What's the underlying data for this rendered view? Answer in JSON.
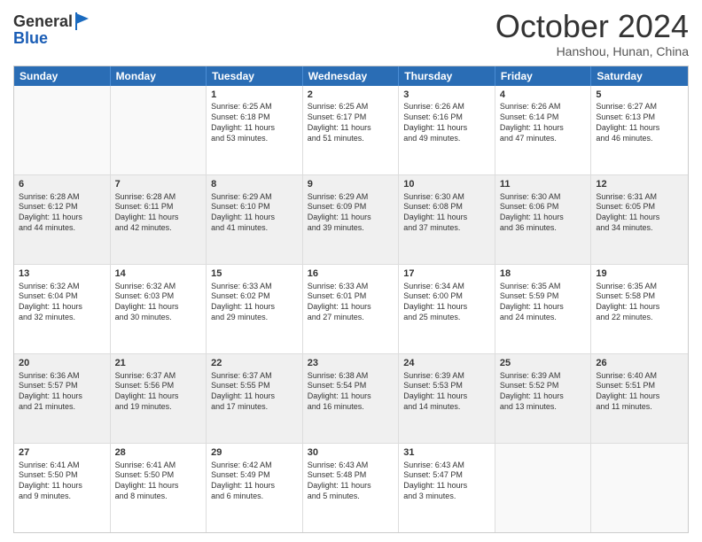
{
  "header": {
    "logo": {
      "line1": "General",
      "line2": "Blue"
    },
    "title": "October 2024",
    "subtitle": "Hanshou, Hunan, China"
  },
  "weekdays": [
    "Sunday",
    "Monday",
    "Tuesday",
    "Wednesday",
    "Thursday",
    "Friday",
    "Saturday"
  ],
  "rows": [
    [
      {
        "day": "",
        "lines": [],
        "empty": true,
        "shaded": false
      },
      {
        "day": "",
        "lines": [],
        "empty": true,
        "shaded": false
      },
      {
        "day": "1",
        "lines": [
          "Sunrise: 6:25 AM",
          "Sunset: 6:18 PM",
          "Daylight: 11 hours",
          "and 53 minutes."
        ],
        "empty": false,
        "shaded": false
      },
      {
        "day": "2",
        "lines": [
          "Sunrise: 6:25 AM",
          "Sunset: 6:17 PM",
          "Daylight: 11 hours",
          "and 51 minutes."
        ],
        "empty": false,
        "shaded": false
      },
      {
        "day": "3",
        "lines": [
          "Sunrise: 6:26 AM",
          "Sunset: 6:16 PM",
          "Daylight: 11 hours",
          "and 49 minutes."
        ],
        "empty": false,
        "shaded": false
      },
      {
        "day": "4",
        "lines": [
          "Sunrise: 6:26 AM",
          "Sunset: 6:14 PM",
          "Daylight: 11 hours",
          "and 47 minutes."
        ],
        "empty": false,
        "shaded": false
      },
      {
        "day": "5",
        "lines": [
          "Sunrise: 6:27 AM",
          "Sunset: 6:13 PM",
          "Daylight: 11 hours",
          "and 46 minutes."
        ],
        "empty": false,
        "shaded": false
      }
    ],
    [
      {
        "day": "6",
        "lines": [
          "Sunrise: 6:28 AM",
          "Sunset: 6:12 PM",
          "Daylight: 11 hours",
          "and 44 minutes."
        ],
        "empty": false,
        "shaded": true
      },
      {
        "day": "7",
        "lines": [
          "Sunrise: 6:28 AM",
          "Sunset: 6:11 PM",
          "Daylight: 11 hours",
          "and 42 minutes."
        ],
        "empty": false,
        "shaded": true
      },
      {
        "day": "8",
        "lines": [
          "Sunrise: 6:29 AM",
          "Sunset: 6:10 PM",
          "Daylight: 11 hours",
          "and 41 minutes."
        ],
        "empty": false,
        "shaded": true
      },
      {
        "day": "9",
        "lines": [
          "Sunrise: 6:29 AM",
          "Sunset: 6:09 PM",
          "Daylight: 11 hours",
          "and 39 minutes."
        ],
        "empty": false,
        "shaded": true
      },
      {
        "day": "10",
        "lines": [
          "Sunrise: 6:30 AM",
          "Sunset: 6:08 PM",
          "Daylight: 11 hours",
          "and 37 minutes."
        ],
        "empty": false,
        "shaded": true
      },
      {
        "day": "11",
        "lines": [
          "Sunrise: 6:30 AM",
          "Sunset: 6:06 PM",
          "Daylight: 11 hours",
          "and 36 minutes."
        ],
        "empty": false,
        "shaded": true
      },
      {
        "day": "12",
        "lines": [
          "Sunrise: 6:31 AM",
          "Sunset: 6:05 PM",
          "Daylight: 11 hours",
          "and 34 minutes."
        ],
        "empty": false,
        "shaded": true
      }
    ],
    [
      {
        "day": "13",
        "lines": [
          "Sunrise: 6:32 AM",
          "Sunset: 6:04 PM",
          "Daylight: 11 hours",
          "and 32 minutes."
        ],
        "empty": false,
        "shaded": false
      },
      {
        "day": "14",
        "lines": [
          "Sunrise: 6:32 AM",
          "Sunset: 6:03 PM",
          "Daylight: 11 hours",
          "and 30 minutes."
        ],
        "empty": false,
        "shaded": false
      },
      {
        "day": "15",
        "lines": [
          "Sunrise: 6:33 AM",
          "Sunset: 6:02 PM",
          "Daylight: 11 hours",
          "and 29 minutes."
        ],
        "empty": false,
        "shaded": false
      },
      {
        "day": "16",
        "lines": [
          "Sunrise: 6:33 AM",
          "Sunset: 6:01 PM",
          "Daylight: 11 hours",
          "and 27 minutes."
        ],
        "empty": false,
        "shaded": false
      },
      {
        "day": "17",
        "lines": [
          "Sunrise: 6:34 AM",
          "Sunset: 6:00 PM",
          "Daylight: 11 hours",
          "and 25 minutes."
        ],
        "empty": false,
        "shaded": false
      },
      {
        "day": "18",
        "lines": [
          "Sunrise: 6:35 AM",
          "Sunset: 5:59 PM",
          "Daylight: 11 hours",
          "and 24 minutes."
        ],
        "empty": false,
        "shaded": false
      },
      {
        "day": "19",
        "lines": [
          "Sunrise: 6:35 AM",
          "Sunset: 5:58 PM",
          "Daylight: 11 hours",
          "and 22 minutes."
        ],
        "empty": false,
        "shaded": false
      }
    ],
    [
      {
        "day": "20",
        "lines": [
          "Sunrise: 6:36 AM",
          "Sunset: 5:57 PM",
          "Daylight: 11 hours",
          "and 21 minutes."
        ],
        "empty": false,
        "shaded": true
      },
      {
        "day": "21",
        "lines": [
          "Sunrise: 6:37 AM",
          "Sunset: 5:56 PM",
          "Daylight: 11 hours",
          "and 19 minutes."
        ],
        "empty": false,
        "shaded": true
      },
      {
        "day": "22",
        "lines": [
          "Sunrise: 6:37 AM",
          "Sunset: 5:55 PM",
          "Daylight: 11 hours",
          "and 17 minutes."
        ],
        "empty": false,
        "shaded": true
      },
      {
        "day": "23",
        "lines": [
          "Sunrise: 6:38 AM",
          "Sunset: 5:54 PM",
          "Daylight: 11 hours",
          "and 16 minutes."
        ],
        "empty": false,
        "shaded": true
      },
      {
        "day": "24",
        "lines": [
          "Sunrise: 6:39 AM",
          "Sunset: 5:53 PM",
          "Daylight: 11 hours",
          "and 14 minutes."
        ],
        "empty": false,
        "shaded": true
      },
      {
        "day": "25",
        "lines": [
          "Sunrise: 6:39 AM",
          "Sunset: 5:52 PM",
          "Daylight: 11 hours",
          "and 13 minutes."
        ],
        "empty": false,
        "shaded": true
      },
      {
        "day": "26",
        "lines": [
          "Sunrise: 6:40 AM",
          "Sunset: 5:51 PM",
          "Daylight: 11 hours",
          "and 11 minutes."
        ],
        "empty": false,
        "shaded": true
      }
    ],
    [
      {
        "day": "27",
        "lines": [
          "Sunrise: 6:41 AM",
          "Sunset: 5:50 PM",
          "Daylight: 11 hours",
          "and 9 minutes."
        ],
        "empty": false,
        "shaded": false
      },
      {
        "day": "28",
        "lines": [
          "Sunrise: 6:41 AM",
          "Sunset: 5:50 PM",
          "Daylight: 11 hours",
          "and 8 minutes."
        ],
        "empty": false,
        "shaded": false
      },
      {
        "day": "29",
        "lines": [
          "Sunrise: 6:42 AM",
          "Sunset: 5:49 PM",
          "Daylight: 11 hours",
          "and 6 minutes."
        ],
        "empty": false,
        "shaded": false
      },
      {
        "day": "30",
        "lines": [
          "Sunrise: 6:43 AM",
          "Sunset: 5:48 PM",
          "Daylight: 11 hours",
          "and 5 minutes."
        ],
        "empty": false,
        "shaded": false
      },
      {
        "day": "31",
        "lines": [
          "Sunrise: 6:43 AM",
          "Sunset: 5:47 PM",
          "Daylight: 11 hours",
          "and 3 minutes."
        ],
        "empty": false,
        "shaded": false
      },
      {
        "day": "",
        "lines": [],
        "empty": true,
        "shaded": false
      },
      {
        "day": "",
        "lines": [],
        "empty": true,
        "shaded": false
      }
    ]
  ]
}
